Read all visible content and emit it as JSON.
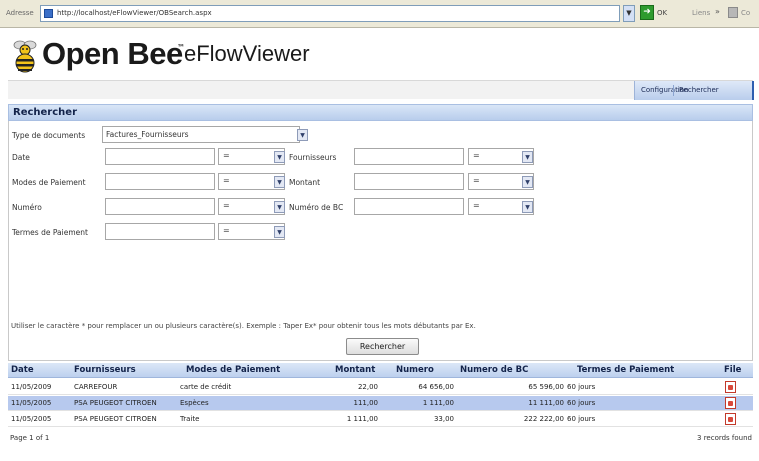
{
  "browser": {
    "address_label": "Adresse",
    "url": "http://localhost/eFlowViewer/OBSearch.aspx",
    "go_label": "OK",
    "links_label": "Liens",
    "toolbar_fragment": "Co"
  },
  "header": {
    "brand": "Open Bee",
    "trademark": "™",
    "product": "eFlowViewer"
  },
  "nav": {
    "configuration": "Configuration",
    "rechercher": "Rechercher"
  },
  "search": {
    "title": "Rechercher",
    "type_label": "Type de documents",
    "type_value": "Factures_Fournisseurs",
    "fields": {
      "date": {
        "label": "Date",
        "value": "",
        "operator": "="
      },
      "fournisseurs": {
        "label": "Fournisseurs",
        "value": "",
        "operator": "="
      },
      "modes": {
        "label": "Modes de Paiement",
        "value": "",
        "operator": "="
      },
      "montant": {
        "label": "Montant",
        "value": "",
        "operator": "="
      },
      "numero": {
        "label": "Numéro",
        "value": "",
        "operator": "="
      },
      "numero_bc": {
        "label": "Numéro de BC",
        "value": "",
        "operator": "="
      },
      "termes": {
        "label": "Termes de Paiement",
        "value": "",
        "operator": "="
      }
    },
    "hint": "Utiliser le caractère * pour remplacer un ou plusieurs caractère(s). Exemple : Taper Ex* pour obtenir tous les mots débutants par Ex.",
    "button": "Rechercher"
  },
  "results": {
    "columns": {
      "date": "Date",
      "fournisseurs": "Fournisseurs",
      "modes": "Modes de Paiement",
      "montant": "Montant",
      "numero": "Numero",
      "numero_bc": "Numero de BC",
      "termes": "Termes de Paiement",
      "file": "File"
    },
    "rows": [
      {
        "date": "11/05/2009",
        "fournisseur": "CARREFOUR",
        "mode": "carte de crédit",
        "montant": "22,00",
        "numero": "64 656,00",
        "numero_bc": "65 596,00",
        "termes": "60 jours",
        "selected": false
      },
      {
        "date": "11/05/2005",
        "fournisseur": "PSA PEUGEOT CITROEN",
        "mode": "Espèces",
        "montant": "111,00",
        "numero": "1 111,00",
        "numero_bc": "11 111,00",
        "termes": "60 jours",
        "selected": true
      },
      {
        "date": "11/05/2005",
        "fournisseur": "PSA PEUGEOT CITROEN",
        "mode": "Traite",
        "montant": "1 111,00",
        "numero": "33,00",
        "numero_bc": "222 222,00",
        "termes": "60 jours",
        "selected": false
      }
    ],
    "pagination": "Page 1 of 1",
    "records_found": "3 records found"
  }
}
